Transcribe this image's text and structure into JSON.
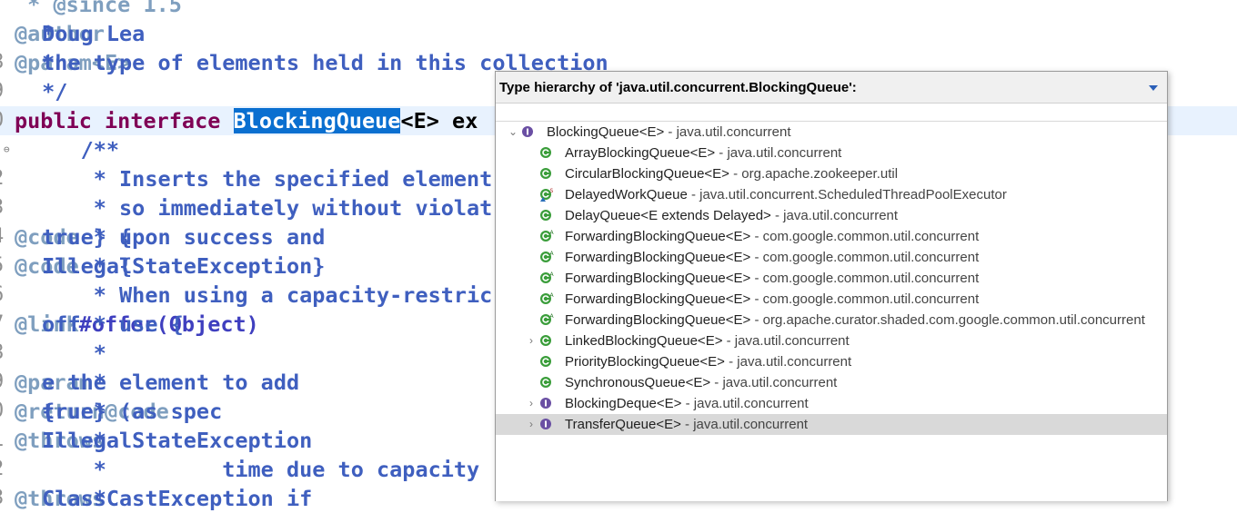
{
  "editor": {
    "lines": [
      {
        "num": "",
        "parts": [
          {
            "c": "tag",
            "t": " * @since 1.5"
          }
        ]
      },
      {
        "num": "",
        "parts": [
          {
            "c": "txt",
            "t": " * "
          },
          {
            "c": "tag",
            "t": "@author"
          },
          {
            "c": "txt",
            "t": " Doug Lea"
          }
        ]
      },
      {
        "num": "8",
        "parts": [
          {
            "c": "txt",
            "t": " * "
          },
          {
            "c": "tag",
            "t": "@param"
          },
          {
            "c": "txt",
            "t": " "
          },
          {
            "c": "tag",
            "t": "<E>"
          },
          {
            "c": "txt",
            "t": " the type of elements held in this collection"
          }
        ]
      },
      {
        "num": "9",
        "parts": [
          {
            "c": "txt",
            "t": " */"
          }
        ]
      },
      {
        "num": "0",
        "current": true,
        "parts": [
          {
            "c": "kw",
            "t": "public interface "
          },
          {
            "c": "sel",
            "t": "BlockingQueue"
          },
          {
            "c": "plain",
            "t": "<E> ex"
          }
        ]
      },
      {
        "num": "",
        "fold": true,
        "parts": [
          {
            "c": "txt",
            "t": "    /**"
          }
        ]
      },
      {
        "num": "2",
        "parts": [
          {
            "c": "txt",
            "t": "     * Inserts the specified element"
          }
        ]
      },
      {
        "num": "3",
        "parts": [
          {
            "c": "txt",
            "t": "     * so immediately without violat"
          }
        ]
      },
      {
        "num": "4",
        "parts": [
          {
            "c": "txt",
            "t": "     * {"
          },
          {
            "c": "tag",
            "t": "@code"
          },
          {
            "c": "txt",
            "t": " true} upon success and"
          }
        ]
      },
      {
        "num": "5",
        "parts": [
          {
            "c": "txt",
            "t": "     * {"
          },
          {
            "c": "tag",
            "t": "@code"
          },
          {
            "c": "txt",
            "t": " IllegalStateException}"
          }
        ]
      },
      {
        "num": "6",
        "parts": [
          {
            "c": "txt",
            "t": "     * When using a capacity-restric"
          }
        ]
      },
      {
        "num": "7",
        "parts": [
          {
            "c": "txt",
            "t": "     * use {"
          },
          {
            "c": "tag",
            "t": "@link"
          },
          {
            "c": "txt",
            "t": " "
          },
          {
            "c": "cref",
            "t": "#offer(Object)"
          },
          {
            "c": "txt",
            "t": " off"
          }
        ]
      },
      {
        "num": "8",
        "parts": [
          {
            "c": "txt",
            "t": "     *"
          }
        ]
      },
      {
        "num": "9",
        "parts": [
          {
            "c": "txt",
            "t": "     * "
          },
          {
            "c": "tag",
            "t": "@param"
          },
          {
            "c": "txt",
            "t": " e the element to add"
          }
        ]
      },
      {
        "num": "0",
        "parts": [
          {
            "c": "txt",
            "t": "     * "
          },
          {
            "c": "tag",
            "t": "@return"
          },
          {
            "c": "txt",
            "t": " {"
          },
          {
            "c": "tag",
            "t": "@code"
          },
          {
            "c": "txt",
            "t": " true} (as spec"
          }
        ]
      },
      {
        "num": "1",
        "parts": [
          {
            "c": "txt",
            "t": "     * "
          },
          {
            "c": "tag",
            "t": "@throws"
          },
          {
            "c": "txt",
            "t": " IllegalStateException"
          }
        ]
      },
      {
        "num": "2",
        "parts": [
          {
            "c": "txt",
            "t": "     *         time due to capacity"
          }
        ]
      },
      {
        "num": "3",
        "parts": [
          {
            "c": "txt",
            "t": "     * "
          },
          {
            "c": "tag",
            "t": "@throws"
          },
          {
            "c": "txt",
            "t": " ClassCastException if"
          }
        ]
      }
    ]
  },
  "popup": {
    "title": "Type hierarchy of 'java.util.concurrent.BlockingQueue':",
    "menu_icon": "chevron-down-icon",
    "filter_value": "",
    "items": [
      {
        "twisty": "expanded",
        "icon": "interface",
        "indent": 0,
        "name": "BlockingQueue<E>",
        "pkg": " - java.util.concurrent"
      },
      {
        "twisty": "",
        "icon": "class",
        "indent": 1,
        "name": "ArrayBlockingQueue<E>",
        "pkg": " - java.util.concurrent"
      },
      {
        "twisty": "",
        "icon": "class",
        "indent": 1,
        "name": "CircularBlockingQueue<E>",
        "pkg": " - org.apache.zookeeper.util"
      },
      {
        "twisty": "",
        "icon": "static-nested-class",
        "indent": 1,
        "name": "DelayedWorkQueue",
        "pkg": " - java.util.concurrent.ScheduledThreadPoolExecutor"
      },
      {
        "twisty": "",
        "icon": "class",
        "indent": 1,
        "name": "DelayQueue<E extends Delayed>",
        "pkg": " - java.util.concurrent"
      },
      {
        "twisty": "",
        "icon": "abstract-class",
        "indent": 1,
        "name": "ForwardingBlockingQueue<E>",
        "pkg": " - com.google.common.util.concurrent"
      },
      {
        "twisty": "",
        "icon": "abstract-class",
        "indent": 1,
        "name": "ForwardingBlockingQueue<E>",
        "pkg": " - com.google.common.util.concurrent"
      },
      {
        "twisty": "",
        "icon": "abstract-class",
        "indent": 1,
        "name": "ForwardingBlockingQueue<E>",
        "pkg": " - com.google.common.util.concurrent"
      },
      {
        "twisty": "",
        "icon": "abstract-class",
        "indent": 1,
        "name": "ForwardingBlockingQueue<E>",
        "pkg": " - com.google.common.util.concurrent"
      },
      {
        "twisty": "",
        "icon": "abstract-class",
        "indent": 1,
        "name": "ForwardingBlockingQueue<E>",
        "pkg": " - org.apache.curator.shaded.com.google.common.util.concurrent"
      },
      {
        "twisty": "collapsed",
        "icon": "class",
        "indent": 1,
        "name": "LinkedBlockingQueue<E>",
        "pkg": " - java.util.concurrent"
      },
      {
        "twisty": "",
        "icon": "class",
        "indent": 1,
        "name": "PriorityBlockingQueue<E>",
        "pkg": " - java.util.concurrent"
      },
      {
        "twisty": "",
        "icon": "class",
        "indent": 1,
        "name": "SynchronousQueue<E>",
        "pkg": " - java.util.concurrent"
      },
      {
        "twisty": "collapsed",
        "icon": "interface",
        "indent": 1,
        "name": "BlockingDeque<E>",
        "pkg": " - java.util.concurrent"
      },
      {
        "twisty": "collapsed",
        "icon": "interface",
        "indent": 1,
        "name": "TransferQueue<E>",
        "pkg": " - java.util.concurrent",
        "selected": true
      }
    ]
  },
  "colors": {
    "class_icon": "#3a9d3a",
    "interface_icon": "#6a4fa3",
    "selection": "#0a6fd0"
  }
}
